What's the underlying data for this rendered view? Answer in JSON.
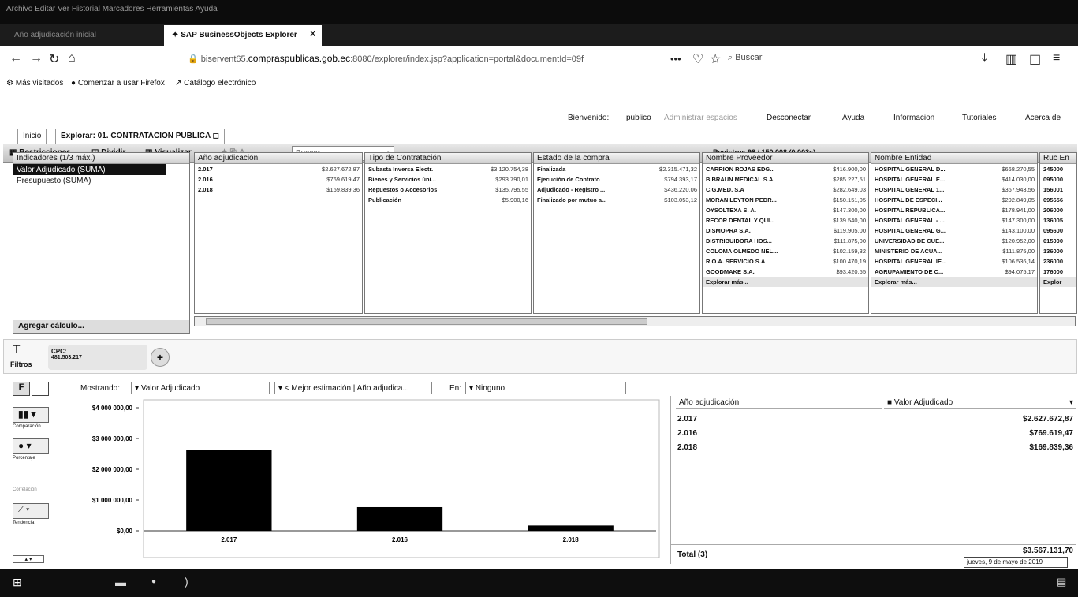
{
  "browser": {
    "titlebar_text": "Archivo   Editar   Ver   Historial   Marcadores   Herramientas   Ayuda",
    "tabs": [
      {
        "label": "Año adjudicación inicial",
        "active": false
      },
      {
        "label": "SAP BusinessObjects Explorer",
        "active": true
      }
    ],
    "close_glyph": "X",
    "url_prefix": "biservent65.",
    "url_domain": "compraspublicas.gob.ec",
    "url_suffix": ":8080/explorer/index.jsp?application=portal&documentId=09f",
    "search_placeholder": "Buscar",
    "bookmarks": [
      "Más visitados",
      "Comenzar a usar Firefox",
      "Catálogo electrónico"
    ]
  },
  "app_header": {
    "welcome": "Bienvenido:",
    "user": "publico",
    "links": [
      "Administrar espacios",
      "Desconectar",
      "Ayuda",
      "Informacion",
      "Tutoriales",
      "Acerca de"
    ]
  },
  "app_tabs": [
    "Inicio",
    "Explorar: 01. CONTRATACION PUBLICA"
  ],
  "toolbar": {
    "restricciones": "Restricciones",
    "dividir": "Dividir",
    "visualizar": "Visualizar",
    "search_placeholder": "Buscar",
    "registros": "Registros 98 / 150,008 (0.003s)"
  },
  "indicators": {
    "header": "Indicadores (1/3 máx.)",
    "items": [
      "Valor Adjudicado (SUMA)",
      "Presupuesto (SUMA)"
    ],
    "add_calc": "Agregar cálculo..."
  },
  "facets": {
    "anio": {
      "header": "Año adjudicación",
      "rows": [
        [
          "2.017",
          "$2.627.672,87"
        ],
        [
          "2.016",
          "$769.619,47"
        ],
        [
          "2.018",
          "$169.839,36"
        ]
      ]
    },
    "tipo": {
      "header": "Tipo de Contratación",
      "rows": [
        [
          "Subasta Inversa Electr.",
          "$3.120.754,38"
        ],
        [
          "Bienes y Servicios úni...",
          "$293.790,01"
        ],
        [
          "Repuestos o Accesorios",
          "$135.795,55"
        ],
        [
          "Publicación",
          "$5.900,16"
        ]
      ]
    },
    "estado": {
      "header": "Estado de la compra",
      "rows": [
        [
          "Finalizada",
          "$2.315.471,32"
        ],
        [
          "Ejecución de Contrato",
          "$794.393,17"
        ],
        [
          "Adjudicado - Registro ...",
          "$436.220,06"
        ],
        [
          "Finalizado por mutuo a...",
          "$103.053,12"
        ]
      ]
    },
    "proveedor": {
      "header": "Nombre Proveedor",
      "rows": [
        [
          "CARRION ROJAS EDG...",
          "$416.900,00"
        ],
        [
          "B.BRAUN MEDICAL S.A.",
          "$285.227,51"
        ],
        [
          "C.G.MED. S.A",
          "$282.649,03"
        ],
        [
          "MORAN LEYTON PEDR...",
          "$150.151,05"
        ],
        [
          "OYSOLTEXA S. A.",
          "$147.300,00"
        ],
        [
          "RECOR DENTAL Y QUI...",
          "$139.540,00"
        ],
        [
          "DISMOPRA S.A.",
          "$119.905,00"
        ],
        [
          "DISTRIBUIDORA HOS...",
          "$111.875,00"
        ],
        [
          "COLOMA OLMEDO NEL...",
          "$102.159,32"
        ],
        [
          "R.O.A. SERVICIO S.A",
          "$100.470,19"
        ],
        [
          "GOODMAKE S.A.",
          "$93.420,55"
        ]
      ],
      "more": "Explorar más..."
    },
    "entidad": {
      "header": "Nombre Entidad",
      "rows": [
        [
          "HOSPITAL GENERAL D...",
          "$668.270,55"
        ],
        [
          "HOSPITAL GENERAL E...",
          "$414.030,00"
        ],
        [
          "HOSPITAL GENERAL 1...",
          "$367.943,56"
        ],
        [
          "HOSPITAL DE ESPECI...",
          "$292.849,05"
        ],
        [
          "HOSPITAL REPUBLICA...",
          "$178.941,00"
        ],
        [
          "HOSPITAL GENERAL - ...",
          "$147.300,00"
        ],
        [
          "HOSPITAL GENERAL G...",
          "$143.100,00"
        ],
        [
          "UNIVERSIDAD DE CUE...",
          "$120.952,00"
        ],
        [
          "MINISTERIO DE ACUA...",
          "$111.875,00"
        ],
        [
          "HOSPITAL GENERAL IE...",
          "$106.536,14"
        ],
        [
          "AGRUPAMIENTO DE C...",
          "$94.075,17"
        ]
      ],
      "more": "Explorar más..."
    },
    "ruc": {
      "header": "Ruc En",
      "rows": [
        "245000",
        "095000",
        "156001",
        "095656",
        "206000",
        "136005",
        "095600",
        "015000",
        "136000",
        "236000",
        "176000"
      ],
      "more": "Explor"
    }
  },
  "filters": {
    "label": "Filtros",
    "chip_title": "CPC:",
    "chip_value": "481.503.217"
  },
  "chart_controls": {
    "mostrando": "Mostrando:",
    "measure": "Valor Adjudicado",
    "dimension": "< Mejor estimación | Año adjudica...",
    "en": "En:",
    "en_value": "Ninguno"
  },
  "sidebar_labels": [
    "Comparación",
    "Porcentaje",
    "Correlación",
    "Tendencia"
  ],
  "chart_data": {
    "type": "bar",
    "categories": [
      "2.017",
      "2.016",
      "2.018"
    ],
    "values": [
      2627672.87,
      769619.47,
      169839.36
    ],
    "y_ticks": [
      "$4 000 000,00",
      "$3 000 000,00",
      "$2 000 000,00",
      "$1 000 000,00",
      "$0,00"
    ],
    "ylim": [
      0,
      4000000
    ],
    "color": "#000000"
  },
  "grid": {
    "col1": "Año adjudicación",
    "col2": "Valor Adjudicado",
    "rows": [
      [
        "2.017",
        "$2.627.672,87"
      ],
      [
        "2.016",
        "$769.619,47"
      ],
      [
        "2.018",
        "$169.839,36"
      ]
    ],
    "total_label": "Total (3)",
    "total_value": "$3.567.131,70"
  },
  "tooltip": "jueves, 9 de mayo de 2019"
}
